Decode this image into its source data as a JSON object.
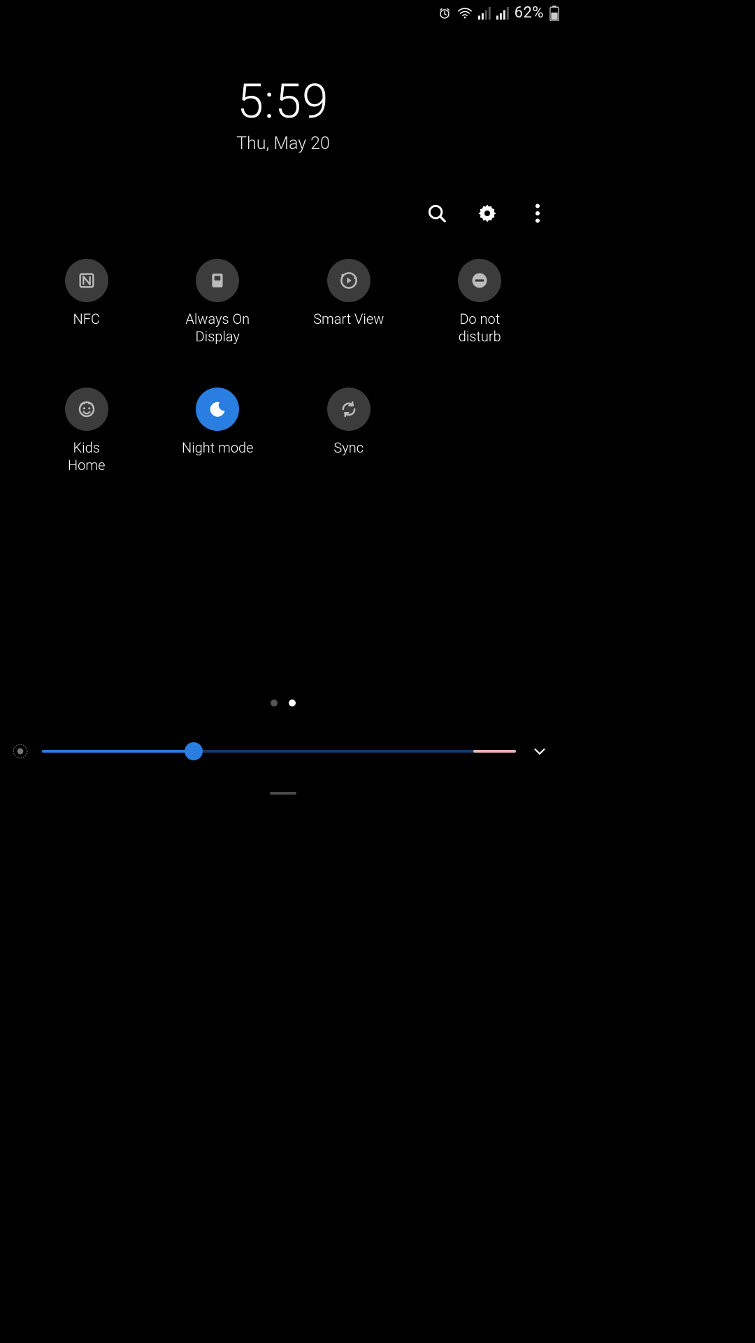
{
  "status": {
    "battery_pct": "62%"
  },
  "clock": {
    "time": "5:59",
    "date": "Thu, May 20"
  },
  "tiles": [
    {
      "id": "nfc",
      "label": "NFC",
      "active": false,
      "icon": "nfc"
    },
    {
      "id": "aod",
      "label": "Always On\nDisplay",
      "active": false,
      "icon": "aod"
    },
    {
      "id": "smartview",
      "label": "Smart View",
      "active": false,
      "icon": "smartview"
    },
    {
      "id": "dnd",
      "label": "Do not\ndisturb",
      "active": false,
      "icon": "dnd"
    },
    {
      "id": "kidshome",
      "label": "Kids\nHome",
      "active": false,
      "icon": "kids"
    },
    {
      "id": "nightmode",
      "label": "Night mode",
      "active": true,
      "icon": "moon"
    },
    {
      "id": "sync",
      "label": "Sync",
      "active": false,
      "icon": "sync"
    }
  ],
  "pages": {
    "count": 2,
    "active": 1
  },
  "brightness": {
    "value": 32,
    "max": 100
  }
}
